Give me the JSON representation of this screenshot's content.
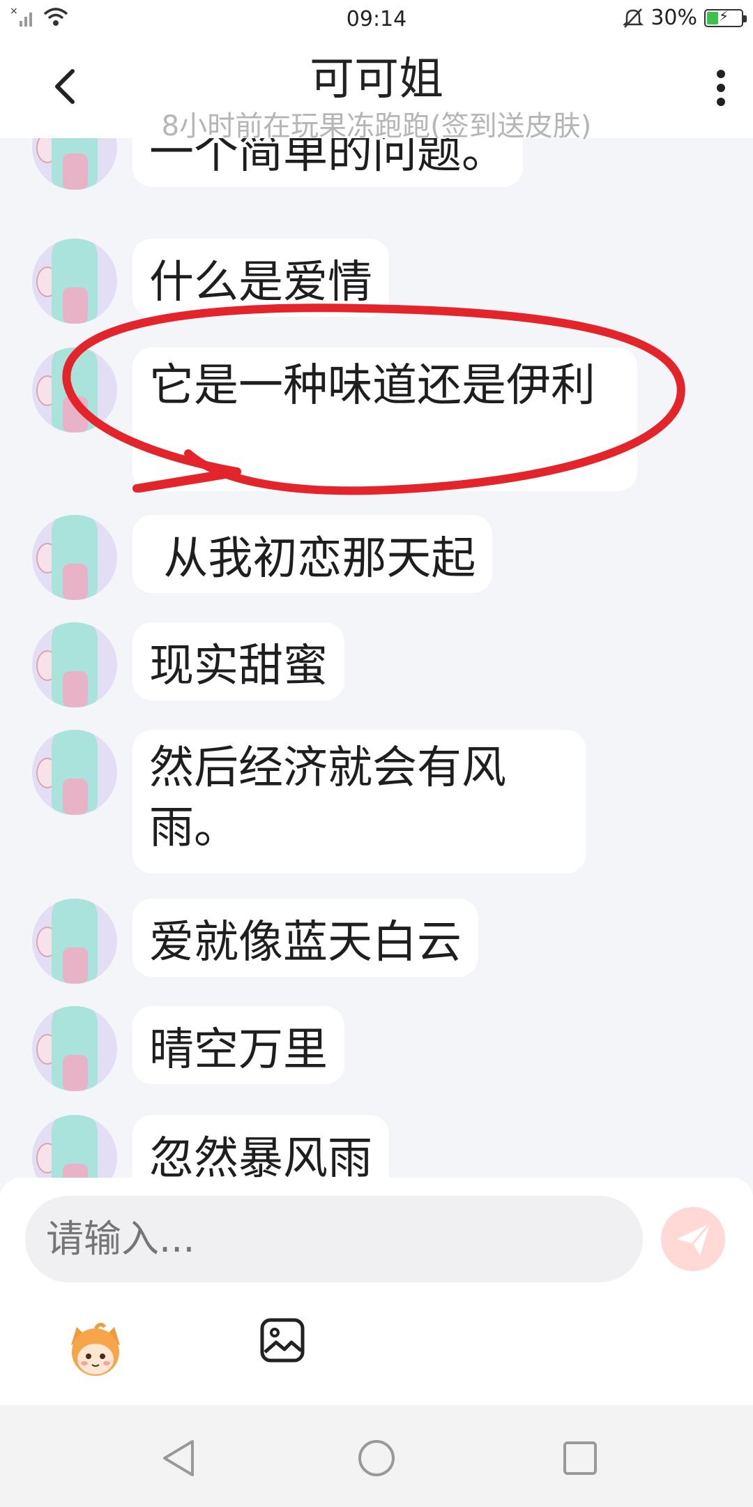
{
  "status_bar": {
    "time": "09:14",
    "battery": "30%",
    "battery_level": 0.3,
    "icons": [
      "no-sim-signal-icon",
      "wifi-icon",
      "mute-bell-icon",
      "battery-charging-icon"
    ]
  },
  "header": {
    "title": "可可姐",
    "subtitle": "8小时前在玩果冻跑跑(签到送皮肤)"
  },
  "messages": [
    {
      "text": "一个简单的问题。"
    },
    {
      "text": "什么是爱情"
    },
    {
      "text": "它是一种味道还是伊利"
    },
    {
      "text": " 从我初恋那天起"
    },
    {
      "text": "现实甜蜜"
    },
    {
      "text": "然后经济就会有风雨。"
    },
    {
      "text": "爱就像蓝天白云"
    },
    {
      "text": "晴空万里"
    },
    {
      "text": "忽然暴风雨"
    }
  ],
  "composer": {
    "placeholder": "请输入..."
  },
  "colors": {
    "annotation": "#e3242b",
    "background": "#f4f5f9",
    "send_button": "#ffd9d6"
  }
}
